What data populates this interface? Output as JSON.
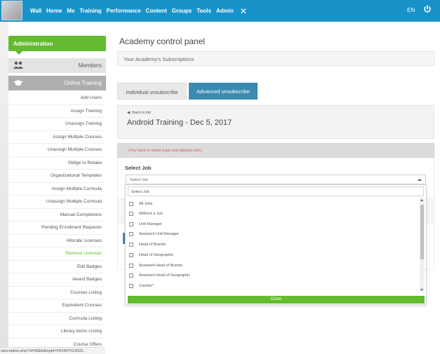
{
  "topbar": {
    "nav": [
      "Wall",
      "Home",
      "Me",
      "Training",
      "Performance",
      "Content",
      "Groups",
      "Tools",
      "Admin"
    ],
    "close_symbol": "✕",
    "lang": "EN",
    "power_icon": "power-icon",
    "background": "#1893c9"
  },
  "sidebar": {
    "title": "Administration",
    "members": "Members",
    "online_training": "Online Training",
    "links": [
      "Add Users",
      "Assign Training",
      "Unassign Training",
      "Assign Multiple Courses",
      "Unassign Multiple Courses",
      "Oblige to Retake",
      "Organizational Templates",
      "Assign Multiple Curricula",
      "Unassign Multiple Curricula",
      "Manual Completions",
      "Pending Enrollment Requests",
      "Allocate Licenses",
      "Remove Licenses",
      "Edit Badges",
      "Award Badges",
      "Courses Listing",
      "Equivalent Courses",
      "Curricula Listing",
      "Library Items Listing",
      "Course Offers"
    ],
    "active_link": "Remove Licenses",
    "accent": "#64bb2f"
  },
  "status_url": "ubscription.php?id=58&billingId=FROM7013033...",
  "main": {
    "title": "Academy control panel",
    "subscriptions": "Your Academy's Subscriptions",
    "tabs": [
      "Individual unsubscribe",
      "Advanced unsubscribe"
    ],
    "back": "Back to list",
    "course": "Android Training - Dec 5, 2017",
    "hint": "(You have to select a job and (above) unit.)",
    "select_label": "Select Job",
    "select_value": "Select Job",
    "search_value": "Select Job",
    "options": [
      "All Jobs",
      "Without a Job",
      "Unit Manager",
      "Assistant Unit Manager",
      "Head of Brands",
      "Head of Geographic",
      "Assistant Head of Brands",
      "Assistant Head of Geographic",
      "Cashier*"
    ],
    "close": "Close"
  }
}
